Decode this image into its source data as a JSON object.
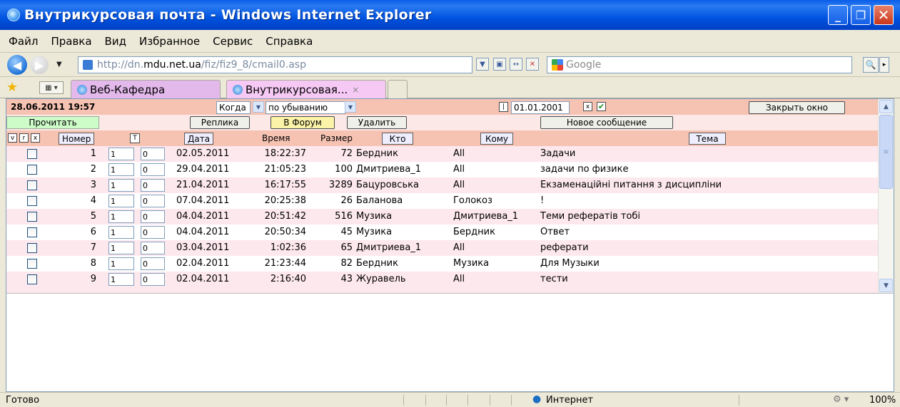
{
  "window": {
    "title": "Внутрикурсовая почта - Windows Internet Explorer"
  },
  "menu": [
    "Файл",
    "Правка",
    "Вид",
    "Избранное",
    "Сервис",
    "Справка"
  ],
  "address": {
    "url_prefix": "http://dn.",
    "url_host": "mdu.net.ua",
    "url_path": "/fiz/fiz9_8/cmail0.asp",
    "search_placeholder": "Google"
  },
  "tabs": [
    {
      "label": "Веб-Кафедра"
    },
    {
      "label": "Внутрикурсовая...",
      "close": "×"
    }
  ],
  "mail": {
    "datetime": "28.06.2011 19:57",
    "sort_field": "Когда",
    "sort_order": "по убыванию",
    "date_filter_marker": "|",
    "date_filter": "01.01.2001",
    "date_clear": "x",
    "close_window": "Закрыть окно",
    "buttons": {
      "read": "Прочитать",
      "reply": "Реплика",
      "to_forum": "В Форум",
      "delete": "Удалить",
      "new_message": "Новое сообщение"
    },
    "header": {
      "v": "v",
      "r": "r",
      "x": "x",
      "number": "Номер",
      "t": "T",
      "date": "Дата",
      "time": "Время",
      "size": "Размер",
      "from": "Кто",
      "to": "Кому",
      "subject": "Тема"
    },
    "rows": [
      {
        "num": "1",
        "a": "1",
        "b": "0",
        "date": "02.05.2011",
        "time": "18:22:37",
        "size": "72",
        "from": "Бердник",
        "to": "All",
        "subject": "Задачи"
      },
      {
        "num": "2",
        "a": "1",
        "b": "0",
        "date": "29.04.2011",
        "time": "21:05:23",
        "size": "100",
        "from": "Дмитриева_1",
        "to": "All",
        "subject": "задачи по физике"
      },
      {
        "num": "3",
        "a": "1",
        "b": "0",
        "date": "21.04.2011",
        "time": "16:17:55",
        "size": "3289",
        "from": "Бацуровська",
        "to": "All",
        "subject": "Екзаменаційні питання з дисципліни"
      },
      {
        "num": "4",
        "a": "1",
        "b": "0",
        "date": "07.04.2011",
        "time": "20:25:38",
        "size": "26",
        "from": "Баланова",
        "to": "Голокоз",
        "subject": "!"
      },
      {
        "num": "5",
        "a": "1",
        "b": "0",
        "date": "04.04.2011",
        "time": "20:51:42",
        "size": "516",
        "from": "Музика",
        "to": "Дмитриева_1",
        "subject": "Теми рефератів тобі"
      },
      {
        "num": "6",
        "a": "1",
        "b": "0",
        "date": "04.04.2011",
        "time": "20:50:34",
        "size": "45",
        "from": "Музика",
        "to": "Бердник",
        "subject": "Ответ"
      },
      {
        "num": "7",
        "a": "1",
        "b": "0",
        "date": "03.04.2011",
        "time": "1:02:36",
        "size": "65",
        "from": "Дмитриева_1",
        "to": "All",
        "subject": "реферати"
      },
      {
        "num": "8",
        "a": "1",
        "b": "0",
        "date": "02.04.2011",
        "time": "21:23:44",
        "size": "82",
        "from": "Бердник",
        "to": "Музика",
        "subject": "Для Музыки"
      },
      {
        "num": "9",
        "a": "1",
        "b": "0",
        "date": "02.04.2011",
        "time": "2:16:40",
        "size": "43",
        "from": "Журавель",
        "to": "All",
        "subject": "тести"
      }
    ]
  },
  "status": {
    "text": "Готово",
    "zone": "Интернет",
    "zoom": "100%"
  }
}
